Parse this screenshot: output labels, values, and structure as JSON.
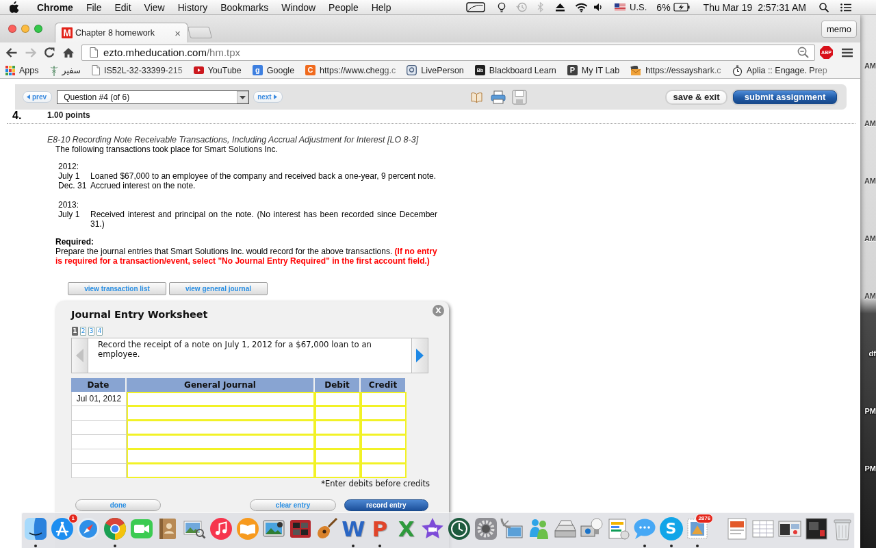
{
  "menu_bar": {
    "app": "Chrome",
    "menus": [
      "File",
      "Edit",
      "View",
      "History",
      "Bookmarks",
      "Window",
      "People",
      "Help"
    ],
    "input_source": "U.S.",
    "battery": "6%",
    "date": "Thu Mar 19",
    "time": "2:57:31 AM"
  },
  "browser": {
    "tab": {
      "favicon": "M",
      "title": "Chapter 8 homework",
      "close": "×"
    },
    "memo": "memo",
    "back": {
      "disabled": false
    },
    "forward": {
      "disabled": true
    },
    "address": {
      "host": "ezto.mheducation.com",
      "path": "/hm.tpx"
    },
    "adblock": "ABP",
    "bookmarks": [
      {
        "kind": "grid",
        "label": "Apps",
        "faded": false
      },
      {
        "kind": "staff",
        "label": "سفير",
        "faded": false
      },
      {
        "kind": "page",
        "label": "IS52L-32-33399-215",
        "faded": true
      },
      {
        "kind": "play",
        "label": "YouTube",
        "faded": false
      },
      {
        "kind": "letter",
        "icon_text": "g",
        "color": "#3d7fe0",
        "label": "Google",
        "faded": false
      },
      {
        "kind": "letter",
        "icon_text": "C",
        "color": "#f06a1d",
        "label": "https://www.chegg.c",
        "faded": true
      },
      {
        "kind": "frame",
        "label": "LivePerson",
        "faded": false
      },
      {
        "kind": "letter",
        "icon_text": "Bb",
        "color": "#1f1f1f",
        "label": "Blackboard Learn",
        "faded": false
      },
      {
        "kind": "letter",
        "icon_text": "P",
        "color": "#3f3f3f",
        "label": "My IT Lab",
        "faded": false
      },
      {
        "kind": "envelope",
        "label": "https://essayshark.c",
        "faded": true
      },
      {
        "kind": "stopwatch",
        "label": "Aplia :: Engage. Prep",
        "faded": true
      }
    ]
  },
  "page": {
    "nav": {
      "prev": "prev",
      "question": "Question #4 (of 6)",
      "next": "next",
      "save_exit": "save & exit",
      "submit": "submit assignment"
    },
    "question_number": "4.",
    "points": "1.00 points",
    "title": "E8-10 Recording Note Receivable Transactions, Including Accrual Adjustment for Interest [LO 8-3]",
    "intro": "The following transactions took place for Smart Solutions Inc.",
    "years": [
      {
        "year": "2012:",
        "entries": [
          {
            "date": "July 1",
            "text": "Loaned $67,000 to an employee of the company and received back a one-year, 9 percent note."
          },
          {
            "date": "Dec. 31",
            "text": "Accrued interest on the note."
          }
        ]
      },
      {
        "year": "2013:",
        "entries": [
          {
            "date": "July 1",
            "text": "Received interest and principal on the note. (No interest has been recorded since December 31.)"
          }
        ]
      }
    ],
    "required_label": "Required:",
    "required_text": "Prepare the journal entries that Smart Solutions Inc. would record for the above transactions. **(If no entry is required for a transaction/event, select \"No Journal Entry Required\" in the first account field.)**",
    "view_buttons": [
      "view transaction list",
      "view general journal"
    ]
  },
  "worksheet": {
    "title": "Journal Entry Worksheet",
    "close": "X",
    "pages": [
      {
        "label": "1",
        "selected": true
      },
      {
        "label": "2",
        "selected": false
      },
      {
        "label": "3",
        "selected": false
      },
      {
        "label": "4",
        "selected": false
      }
    ],
    "prev_arrow": {
      "disabled": true
    },
    "next_arrow": {
      "disabled": false
    },
    "instruction": "Record the receipt of a note on July 1, 2012 for a $67,000 loan to an employee.",
    "columns": [
      "Date",
      "General Journal",
      "Debit",
      "Credit"
    ],
    "rows": [
      {
        "date": "Jul 01, 2012"
      },
      {},
      {},
      {},
      {},
      {}
    ],
    "note": "*Enter debits before credits",
    "buttons": [
      {
        "label": "done",
        "kind": "plain"
      },
      {
        "label": "clear entry",
        "kind": "plain"
      },
      {
        "label": "record entry",
        "kind": "primary"
      }
    ]
  },
  "desktop_labels": [
    "AM",
    "AM",
    "AM",
    "AM",
    "AM",
    "df",
    "PM",
    "PM"
  ],
  "dock": {
    "apps": [
      {
        "kind": "split",
        "running": true
      },
      {
        "kind": "pencils",
        "badge": "1",
        "running": false
      },
      {
        "kind": "compass",
        "running": false
      },
      {
        "kind": "ring",
        "running": true
      },
      {
        "kind": "camera",
        "running": false
      },
      {
        "kind": "book",
        "running": false
      },
      {
        "kind": "photos",
        "running": false
      },
      {
        "kind": "note",
        "running": false
      },
      {
        "kind": "openbook",
        "running": false
      },
      {
        "kind": "scenery",
        "running": false
      },
      {
        "kind": "booth",
        "running": false
      },
      {
        "kind": "guitar",
        "running": false
      },
      {
        "kind": "letter",
        "letter": "W",
        "color": "#2a66c4",
        "running": true
      },
      {
        "kind": "letter",
        "letter": "P",
        "color": "#e0452a",
        "running": true
      },
      {
        "kind": "letter",
        "letter": "X",
        "color": "#2e9a3c",
        "running": false
      },
      {
        "kind": "star",
        "running": false
      },
      {
        "kind": "clock",
        "running": false
      },
      {
        "kind": "gear",
        "running": false
      },
      {
        "kind": "satellite",
        "running": false
      },
      {
        "kind": "people",
        "running": false
      },
      {
        "kind": "scanner",
        "running": false
      },
      {
        "kind": "bulb",
        "running": false
      },
      {
        "kind": "chartdoc",
        "running": false
      },
      {
        "kind": "bubble",
        "running": true
      },
      {
        "kind": "disc",
        "letter": "S",
        "color": "#12a5e8",
        "running": true
      },
      {
        "kind": "stamp",
        "badge": "2876",
        "running": true
      }
    ],
    "files": [
      {
        "kind": "slides"
      },
      {
        "kind": "table"
      },
      {
        "kind": "screenshot"
      },
      {
        "kind": "darkphoto"
      },
      {
        "kind": "trash"
      }
    ]
  }
}
